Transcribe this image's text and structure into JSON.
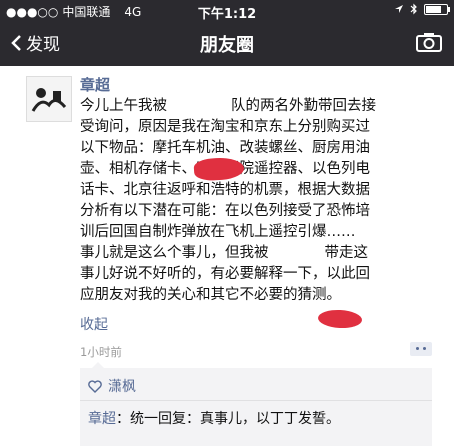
{
  "status_bar": {
    "signal": "●●●○○",
    "carrier": "中国联通",
    "network": "4G",
    "time": "下午1:12"
  },
  "nav": {
    "back_label": "发现",
    "title": "朋友圈",
    "camera_icon": "camera-icon"
  },
  "post": {
    "author": "章超",
    "lines": [
      "今儿上午我被",
      "队的两名外勤带回去接",
      "受询问，原因是我在淘宝和京东上分别购买过",
      "以下物品：摩托车机油、改装螺丝、厨房用油",
      "壶、相机存储卡、家庭影院遥控器、以色列电",
      "话卡、北京往返呼和浩特的机票，根据大数据",
      "分析有以下潜在可能：在以色列接受了恐怖培",
      "训后回国自制炸弹放在飞机上遥控引爆……",
      "事儿就是这么个事儿，但我被",
      "带走这",
      "事儿好说不好听的，有必要解释一下，以此回",
      "应朋友对我的关心和其它不必要的猜测。"
    ],
    "collapse_label": "收起",
    "time": "1小时前",
    "likes": {
      "icon": "heart-icon",
      "names": "潇枫"
    },
    "comments": [
      {
        "author": "章超",
        "sep": "：",
        "text": "统一回复：真事儿，以丁丁发誓。"
      }
    ]
  },
  "colors": {
    "nav_bg": "#2b2a2f",
    "link": "#576b95",
    "redaction": "#e03040"
  }
}
